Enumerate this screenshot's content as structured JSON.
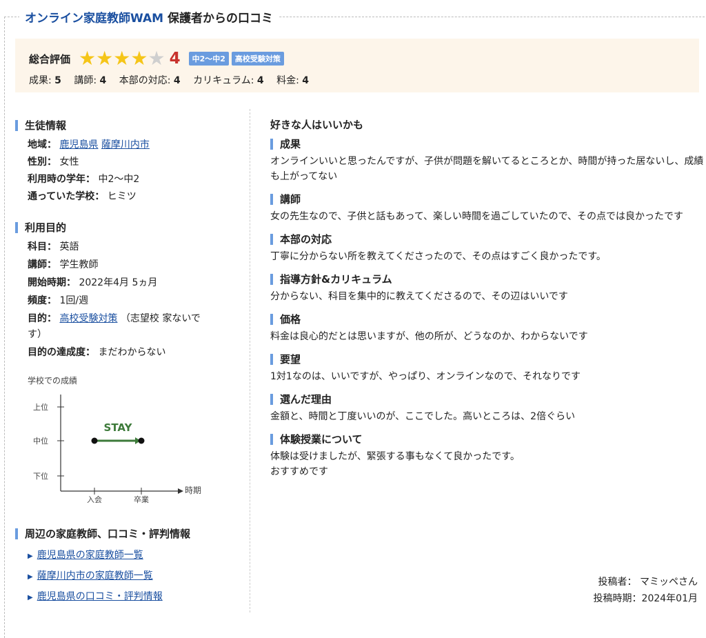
{
  "title": {
    "brand": "オンライン家庭教師WAM",
    "suffix": " 保護者からの口コミ"
  },
  "summary": {
    "label": "総合評価",
    "rating": 4,
    "score": "4",
    "tags": [
      "中2〜中2",
      "高校受験対策"
    ],
    "scores": [
      {
        "label": "成果: ",
        "value": "5"
      },
      {
        "label": "講師: ",
        "value": "4"
      },
      {
        "label": "本部の対応: ",
        "value": "4"
      },
      {
        "label": "カリキュラム: ",
        "value": "4"
      },
      {
        "label": "料金: ",
        "value": "4"
      }
    ],
    "colors": {
      "star": "#f5c518",
      "score": "#c8322c",
      "tag": "#6a9cdf"
    }
  },
  "student": {
    "heading": "生徒情報",
    "region_label": "地域",
    "region_pref": "鹿児島県",
    "region_city": "薩摩川内市",
    "gender_label": "性別",
    "gender": "女性",
    "grade_label": "利用時の学年",
    "grade": "中2〜中2",
    "school_label": "通っていた学校",
    "school": "ヒミツ"
  },
  "purpose": {
    "heading": "利用目的",
    "subject_label": "科目",
    "subject": "英語",
    "teacher_label": "講師",
    "teacher": "学生教師",
    "start_label": "開始時期",
    "start": "2022年4月 5ヵ月",
    "freq_label": "頻度",
    "freq": "1回/週",
    "goal_label": "目的",
    "goal_link": "高校受験対策",
    "goal_note_1": "（志望校 家ないで",
    "goal_note_2": "す）",
    "achieve_label": "目的の達成度",
    "achieve": "まだわからない"
  },
  "grade_chart": {
    "title": "学校での成績",
    "levels": [
      "上位",
      "中位",
      "下位"
    ],
    "x_axis_label": "時期",
    "x_points": [
      "入会",
      "卒業"
    ],
    "status": "STAY",
    "start_level": "中位",
    "end_level": "中位"
  },
  "nearby": {
    "heading": "周辺の家庭教師、口コミ・評判情報",
    "links": [
      "鹿児島県の家庭教師一覧",
      "薩摩川内市の家庭教師一覧",
      "鹿児島県の口コミ・評判情報"
    ]
  },
  "review": {
    "lead": "好きな人はいいかも",
    "sections": [
      {
        "title": "成果",
        "text": "オンラインいいと思ったんですが、子供が問題を解いてるところとか、時間が持った居ないし、成績も上がってない"
      },
      {
        "title": "講師",
        "text": "女の先生なので、子供と話もあって、楽しい時間を過ごしていたので、その点では良かったです"
      },
      {
        "title": "本部の対応",
        "text": "丁寧に分からない所を教えてくださったので、その点はすごく良かったです。"
      },
      {
        "title": "指導方針&カリキュラム",
        "text": "分からない、科目を集中的に教えてくださるので、その辺はいいです"
      },
      {
        "title": "価格",
        "text": "料金は良心的だとは思いますが、他の所が、どうなのか、わからないです"
      },
      {
        "title": "要望",
        "text": "1対1なのは、いいですが、やっぱり、オンラインなので、それなりです"
      },
      {
        "title": "選んだ理由",
        "text": "金額と、時間と丁度いいのが、ここでした。高いところは、2倍ぐらい"
      },
      {
        "title": "体験授業について",
        "text": "体験は受けましたが、緊張する事もなくて良かったです。\nおすすめです"
      }
    ]
  },
  "poster": {
    "label": "投稿者：",
    "name": "マミッペさん",
    "date_label": "投稿時期：",
    "date": "2024年01月"
  }
}
